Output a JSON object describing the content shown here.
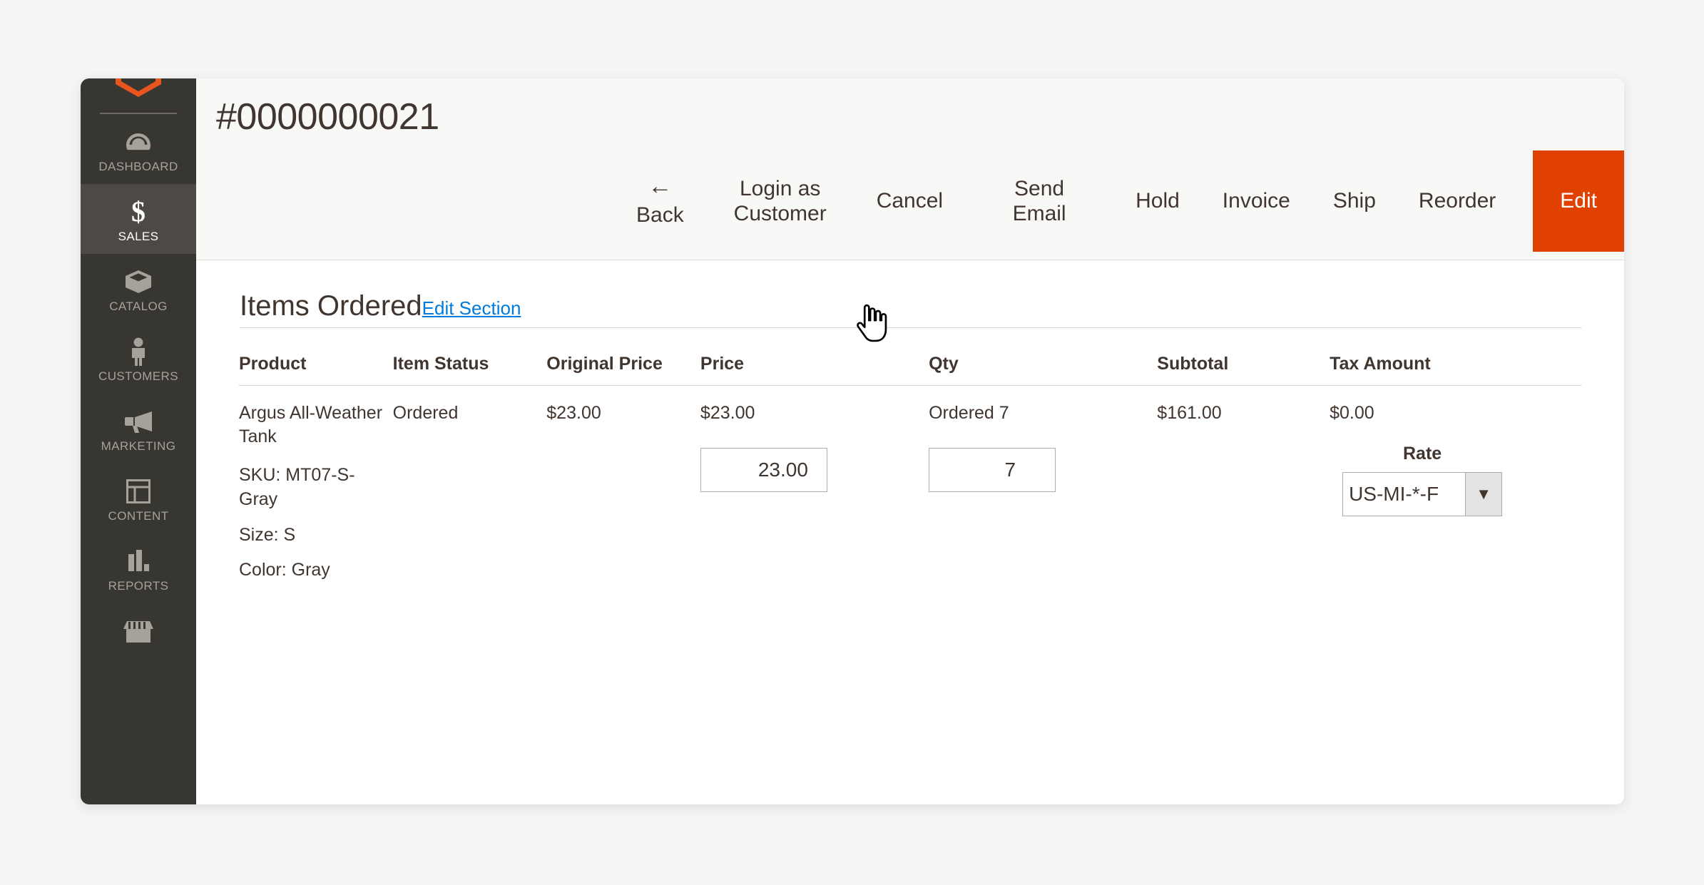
{
  "sidebar": {
    "logo_color": "#e8551f",
    "items": [
      {
        "label": "DASHBOARD",
        "icon": "gauge-icon",
        "active": false
      },
      {
        "label": "SALES",
        "icon": "dollar-icon",
        "active": true
      },
      {
        "label": "CATALOG",
        "icon": "box-icon",
        "active": false
      },
      {
        "label": "CUSTOMERS",
        "icon": "person-icon",
        "active": false
      },
      {
        "label": "MARKETING",
        "icon": "megaphone-icon",
        "active": false
      },
      {
        "label": "CONTENT",
        "icon": "layout-icon",
        "active": false
      },
      {
        "label": "REPORTS",
        "icon": "bar-chart-icon",
        "active": false
      },
      {
        "label": "",
        "icon": "store-icon",
        "active": false
      }
    ]
  },
  "header": {
    "title": "#0000000021",
    "actions": [
      {
        "label": "Back",
        "icon": "arrow-left-icon",
        "primary": false
      },
      {
        "label": "Login as Customer",
        "icon": "",
        "primary": false
      },
      {
        "label": "Cancel",
        "icon": "",
        "primary": false
      },
      {
        "label": "Send Email",
        "icon": "",
        "primary": false
      },
      {
        "label": "Hold",
        "icon": "",
        "primary": false
      },
      {
        "label": "Invoice",
        "icon": "",
        "primary": false
      },
      {
        "label": "Ship",
        "icon": "",
        "primary": false
      },
      {
        "label": "Reorder",
        "icon": "",
        "primary": false
      },
      {
        "label": "Edit",
        "icon": "",
        "primary": true
      }
    ],
    "primary_color": "#e04000"
  },
  "section": {
    "title": "Items Ordered",
    "edit_link": "Edit Section",
    "link_color": "#007bdb"
  },
  "table": {
    "headers": {
      "product": "Product",
      "item_status": "Item Status",
      "original_price": "Original Price",
      "price": "Price",
      "qty": "Qty",
      "subtotal": "Subtotal",
      "tax_amount": "Tax Amount"
    },
    "row": {
      "product_name": "Argus All-Weather Tank",
      "sku": "SKU: MT07-S-Gray",
      "size": "Size: S",
      "color": "Color: Gray",
      "item_status": "Ordered",
      "original_price": "$23.00",
      "price": "$23.00",
      "price_input": "23.00",
      "qty_text": "Ordered 7",
      "qty_input": "7",
      "subtotal": "$161.00",
      "tax_amount": "$0.00",
      "rate_label": "Rate",
      "rate_value": "US-MI-*-F"
    }
  }
}
